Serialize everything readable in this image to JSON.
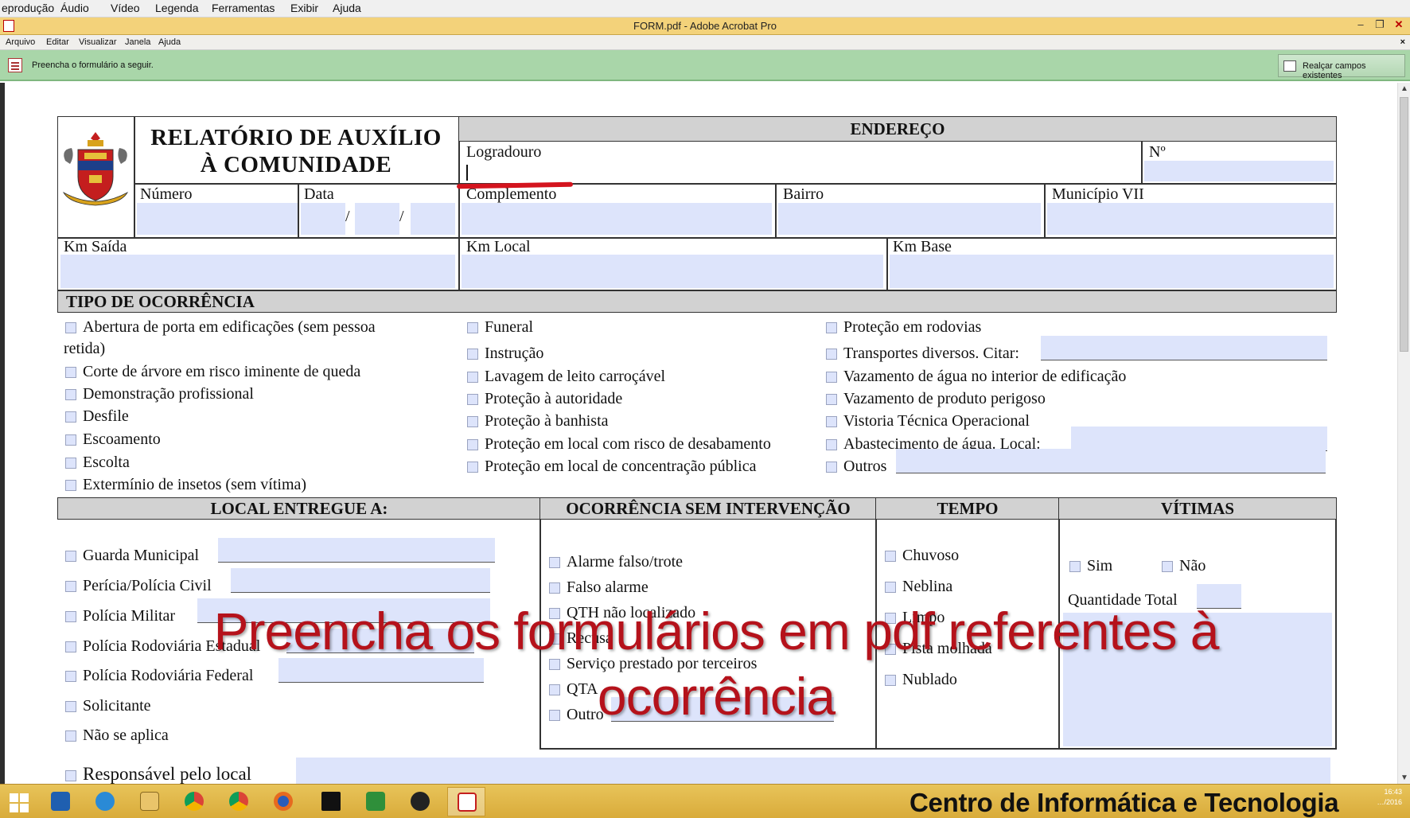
{
  "background_app_menu": [
    "eprodução",
    "Áudio",
    "Vídeo",
    "Legenda",
    "Ferramentas",
    "Exibir",
    "Ajuda"
  ],
  "window": {
    "title": "FORM.pdf - Adobe Acrobat Pro",
    "minimize": "–",
    "restore": "❐",
    "close": "✕"
  },
  "acrobat_menu": [
    "Arquivo",
    "Editar",
    "Visualizar",
    "Janela",
    "Ajuda"
  ],
  "acrobat_menu_close": "×",
  "form_bar": {
    "message": "Preencha o formulário a seguir.",
    "highlight_button": "Realçar campos existentes"
  },
  "form": {
    "title_line1": "RELATÓRIO DE AUXÍLIO",
    "title_line2": "À COMUNIDADE",
    "endereco_header": "ENDEREÇO",
    "labels": {
      "logradouro": "Logradouro",
      "numero_endereco": "Nº",
      "numero": "Número",
      "data": "Data",
      "data_sep": "/",
      "complemento": "Complemento",
      "bairro": "Bairro",
      "municipio": "Município VII",
      "km_saida": "Km Saída",
      "km_local": "Km Local",
      "km_base": "Km Base"
    },
    "tipo_header": "TIPO DE OCORRÊNCIA",
    "tipo_col1": [
      "Abertura de porta em edificações (sem pessoa",
      "Corte de árvore em risco iminente de queda",
      "Demonstração profissional",
      "Desfile",
      "Escoamento",
      "Escolta",
      "Extermínio de insetos (sem vítima)"
    ],
    "tipo_col1_wrap": "retida)",
    "tipo_col2": [
      "Funeral",
      "Instrução",
      "Lavagem de leito carroçável",
      "Proteção à autoridade",
      "Proteção à banhista",
      "Proteção em local com risco de desabamento",
      "Proteção em local de concentração pública"
    ],
    "tipo_col3": [
      "Proteção em rodovias",
      "Transportes diversos. Citar:",
      "Vazamento de água no interior de edificação",
      "Vazamento de produto perigoso",
      "Vistoria Técnica Operacional",
      "Abastecimento de água. Local:",
      "Outros"
    ],
    "local_header": "LOCAL ENTREGUE A:",
    "local_items": [
      "Guarda Municipal",
      "Perícia/Polícia Civil",
      "Polícia Militar",
      "Polícia Rodoviária Estadual",
      "Polícia Rodoviária Federal",
      "Solicitante",
      "Não se aplica"
    ],
    "sem_intervencao_header": "OCORRÊNCIA SEM INTERVENÇÃO",
    "sem_intervencao_items": [
      "Alarme falso/trote",
      "Falso alarme",
      "QTH não localizado",
      "Recusa",
      "Serviço prestado por terceiros",
      "QTA",
      "Outro"
    ],
    "tempo_header": "TEMPO",
    "tempo_items": [
      "Chuvoso",
      "Neblina",
      "Limpo",
      "Pista molhada",
      "Nublado"
    ],
    "vitimas_header": "VÍTIMAS",
    "vitimas_sim": "Sim",
    "vitimas_nao": "Não",
    "quantidade_total": "Quantidade Total",
    "responsavel": "Responsável pelo local"
  },
  "overlay_caption_line1": "Preencha os formulários em pdf referentes à",
  "overlay_caption_line2": "ocorrência",
  "taskbar": {
    "icons": [
      "windows-start-icon",
      "outlook-icon",
      "internet-explorer-icon",
      "file-explorer-icon",
      "chrome-icon",
      "chrome-icon",
      "firefox-icon",
      "terminal-icon",
      "camtasia-icon",
      "film-reel-icon",
      "acrobat-icon"
    ],
    "brand": "Centro de Informática e Tecnologia",
    "clock_time": "16:43",
    "clock_date": "…/2016"
  },
  "colors": {
    "titlebar": "#f3d27a",
    "formbar": "#a9d6a9",
    "field": "#dde4fb",
    "overlay_text": "#b5121b",
    "taskbar": "#e0b84a"
  }
}
